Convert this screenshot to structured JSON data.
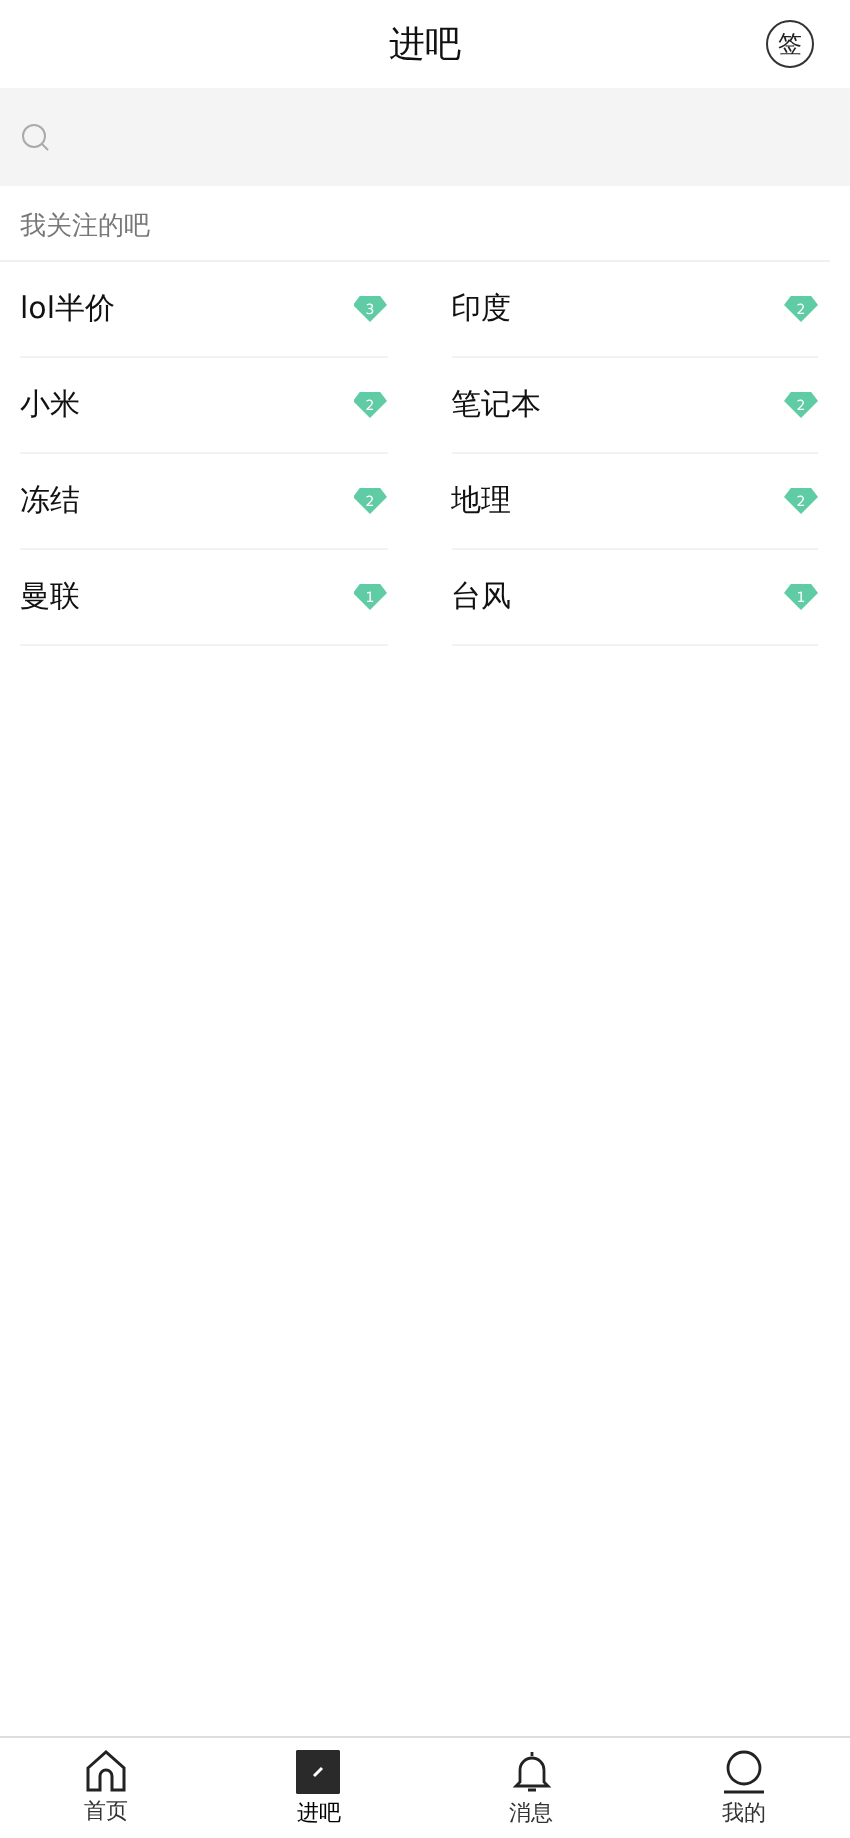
{
  "header": {
    "title": "进吧",
    "sign_label": "签"
  },
  "section_title": "我关注的吧",
  "forums": [
    {
      "name": "lol半价",
      "level_badge": "3"
    },
    {
      "name": "印度",
      "level_badge": "2"
    },
    {
      "name": "小米",
      "level_badge": "2"
    },
    {
      "name": "笔记本",
      "level_badge": "2"
    },
    {
      "name": "冻结",
      "level_badge": "2"
    },
    {
      "name": "地理",
      "level_badge": "2"
    },
    {
      "name": "曼联",
      "level_badge": "1"
    },
    {
      "name": "台风",
      "level_badge": "1"
    }
  ],
  "tab_bar": [
    {
      "label": "首页",
      "kind": "home",
      "selected": false
    },
    {
      "label": "进吧",
      "kind": "enter",
      "selected": true
    },
    {
      "label": "消息",
      "kind": "bell",
      "selected": false
    },
    {
      "label": "我的",
      "kind": "profile",
      "selected": false
    }
  ]
}
